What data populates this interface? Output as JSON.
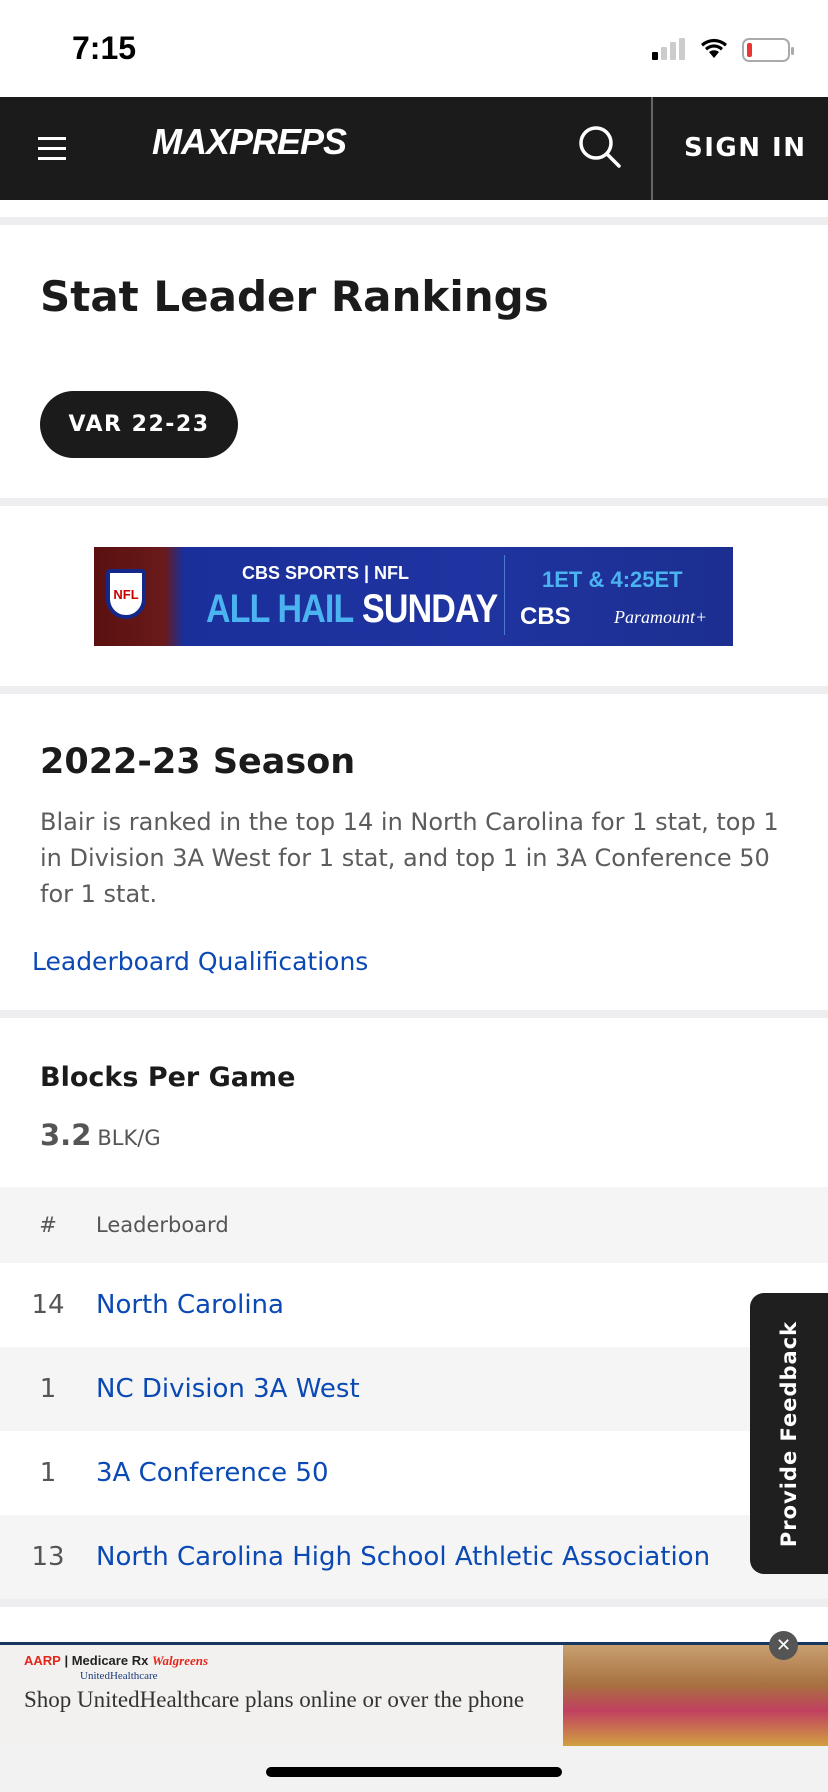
{
  "status_bar": {
    "time": "7:15",
    "icons": [
      "cellular-signal-icon",
      "wifi-icon",
      "battery-low-icon"
    ],
    "battery_color": "#e33333"
  },
  "header": {
    "logo": "MAXPREPS",
    "search_icon": "search-icon",
    "menu_icon": "hamburger-menu-icon",
    "sign_in": "SIGN IN"
  },
  "page": {
    "title": "Stat Leader Rankings",
    "season_pill": "VAR 22-23"
  },
  "ad_banner": {
    "line1": "CBS SPORTS | NFL",
    "headline_a": "ALL HAIL",
    "headline_b": "SUNDAY",
    "times": "1ET & 4:25ET",
    "network": "CBS",
    "streaming": "Paramount+",
    "nfl": "NFL"
  },
  "season": {
    "heading": "2022-23 Season",
    "description": "Blair is ranked in the top 14 in North Carolina for 1 stat, top 1 in Division 3A West for 1 stat, and top 1 in 3A Conference 50 for 1 stat.",
    "link": "Leaderboard Qualifications"
  },
  "stat": {
    "name": "Blocks Per Game",
    "value": "3.2",
    "unit": "BLK/G",
    "columns": [
      "#",
      "Leaderboard"
    ],
    "rows": [
      {
        "rank": "14",
        "leaderboard": "North Carolina"
      },
      {
        "rank": "1",
        "leaderboard": "NC Division 3A West"
      },
      {
        "rank": "1",
        "leaderboard": "3A Conference 50"
      },
      {
        "rank": "13",
        "leaderboard": "North Carolina High School Athletic Association"
      }
    ]
  },
  "feedback": "Provide Feedback",
  "bottom_ad": {
    "brand_aarp": "AARP",
    "brand_medicare": "Medicare Rx",
    "brand_walgreens": "Walgreens",
    "brand_uhc": "UnitedHealthcare",
    "copy": "Shop UnitedHealthcare plans online or over the phone",
    "close": "✕"
  },
  "colors": {
    "header_bg": "#1b1b1b",
    "link": "#0b49b5",
    "band": "#eeeef0"
  }
}
